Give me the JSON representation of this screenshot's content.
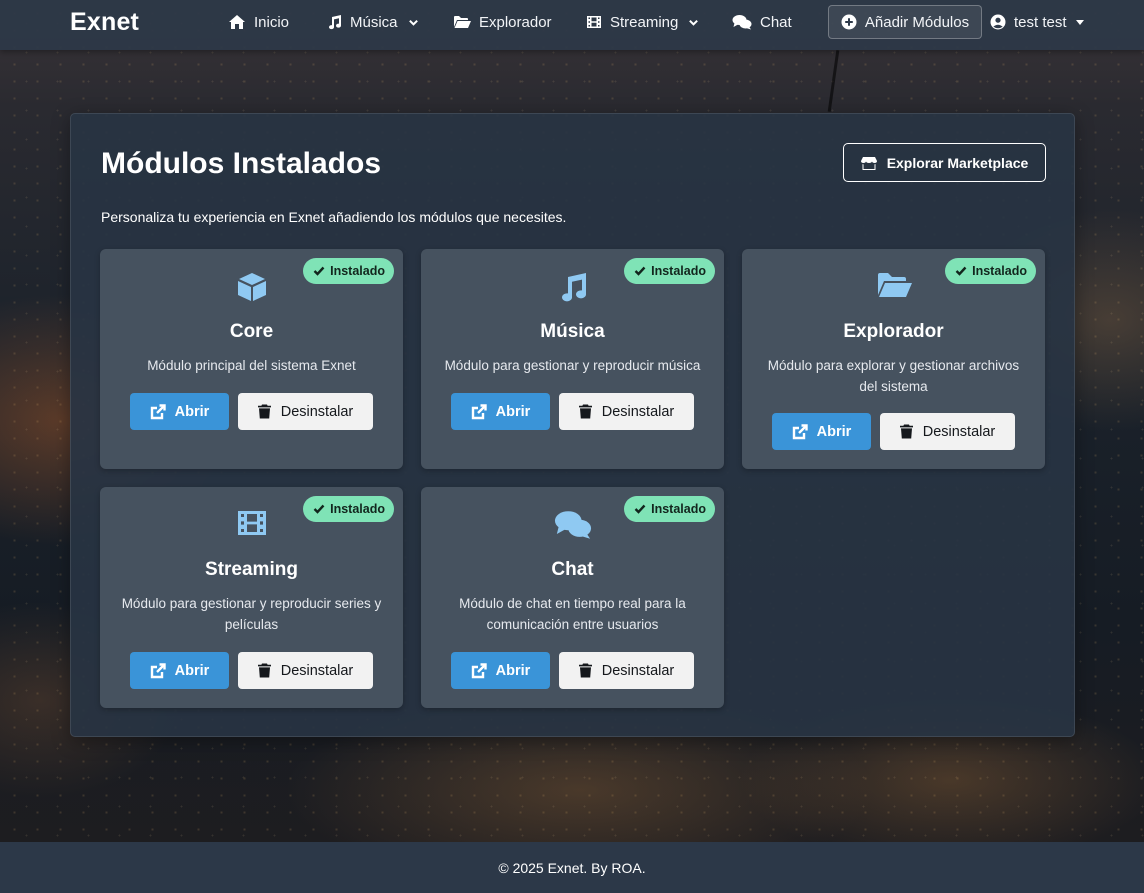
{
  "app": {
    "brand": "Exnet"
  },
  "nav": {
    "items": [
      {
        "label": "Inicio",
        "icon": "home-icon"
      },
      {
        "label": "Música",
        "icon": "music-icon",
        "dropdown": true
      },
      {
        "label": "Explorador",
        "icon": "folder-open-icon"
      },
      {
        "label": "Streaming",
        "icon": "film-icon",
        "dropdown": true
      },
      {
        "label": "Chat",
        "icon": "comments-icon"
      }
    ],
    "add_modules_label": "Añadir Módulos",
    "user_label": "test test"
  },
  "main": {
    "title": "Módulos Instalados",
    "marketplace_label": "Explorar Marketplace",
    "description": "Personaliza tu experiencia en Exnet añadiendo los módulos que necesites.",
    "badge_label": "Instalado",
    "open_label": "Abrir",
    "uninstall_label": "Desinstalar",
    "modules": [
      {
        "name": "Core",
        "icon": "cube-icon",
        "description": "Módulo principal del sistema Exnet"
      },
      {
        "name": "Música",
        "icon": "music-icon",
        "description": "Módulo para gestionar y reproducir música"
      },
      {
        "name": "Explorador",
        "icon": "folder-open-icon",
        "description": "Módulo para explorar y gestionar archivos del sistema"
      },
      {
        "name": "Streaming",
        "icon": "film-icon",
        "description": "Módulo para gestionar y reproducir series y películas"
      },
      {
        "name": "Chat",
        "icon": "comments-icon",
        "description": "Módulo de chat en tiempo real para la comunicación entre usuarios"
      }
    ]
  },
  "footer": {
    "text": "© 2025 Exnet. By ROA."
  },
  "colors": {
    "navbar": "#2c3848",
    "card": "#46525f",
    "badge": "#7fe3b6",
    "open_button": "#3a94d8",
    "icon": "#8fc9f2"
  }
}
